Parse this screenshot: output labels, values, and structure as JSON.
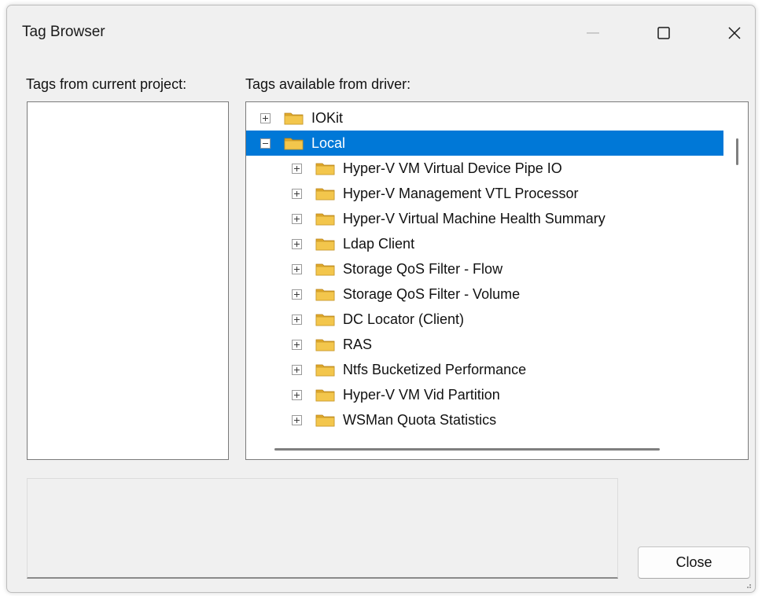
{
  "window": {
    "title": "Tag Browser"
  },
  "labels": {
    "current_project": "Tags from current project:",
    "available": "Tags available from driver:"
  },
  "tree": {
    "items": [
      {
        "label": "IOKit",
        "expanded": false,
        "level": 0
      },
      {
        "label": "Local",
        "expanded": true,
        "level": 0,
        "selected": true
      },
      {
        "label": "Hyper-V VM Virtual Device Pipe IO",
        "level": 1
      },
      {
        "label": "Hyper-V Management VTL Processor",
        "level": 1
      },
      {
        "label": "Hyper-V Virtual Machine Health Summary",
        "level": 1
      },
      {
        "label": "Ldap Client",
        "level": 1
      },
      {
        "label": "Storage QoS Filter - Flow",
        "level": 1
      },
      {
        "label": "Storage QoS Filter - Volume",
        "level": 1
      },
      {
        "label": "DC Locator (Client)",
        "level": 1
      },
      {
        "label": "RAS",
        "level": 1
      },
      {
        "label": "Ntfs Bucketized Performance",
        "level": 1
      },
      {
        "label": "Hyper-V VM Vid Partition",
        "level": 1
      },
      {
        "label": "WSMan Quota Statistics",
        "level": 1
      }
    ]
  },
  "buttons": {
    "close": "Close"
  },
  "colors": {
    "selection": "#0078d7",
    "window_bg": "#f0f0f0",
    "folder": "#f3c64c"
  }
}
